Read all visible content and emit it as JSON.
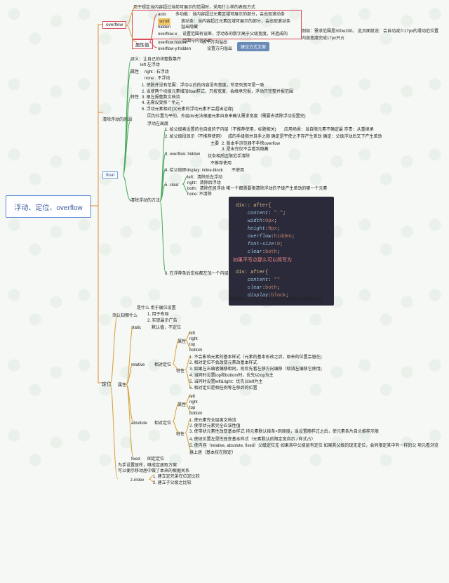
{
  "root": "浮动、定位、overflow",
  "overflow": {
    "title": "overflow",
    "desc": "用于规定当内容超过当前可展示的范围时，采用什么样的表现方式",
    "vals": {
      "label": "属性值",
      "items": [
        {
          "k": "auto",
          "v": "多功能：当内容超过元素区域可展示的部分，会出现滚动条"
        },
        {
          "k": "scroll",
          "v": "滚动条：当内容超过元素区域可展示的部分，会出现滚动条"
        },
        {
          "k": "hidden",
          "v": "溢出隐藏"
        },
        {
          "k": "overflow-x",
          "v": "设置范围有误差，浮动条的数字高于父级宽度，将造成的范围与内容不合",
          "ex": "例如：需求范围是300w200。 此页面就说：会自动减少17px的滑动范位置内容宽度完成17px只占"
        },
        {
          "k": "overflow:hidden",
          "v": "水平方向溢出"
        },
        {
          "k": "overflow-y:hidden",
          "v": "设置方向溢出"
        }
      ],
      "tag": "建议方式文案"
    }
  },
  "float": {
    "title": "float",
    "intro": "译义：让自己的块整数靠齐",
    "props": {
      "label": "属性",
      "left": "left  左浮动",
      "right": "right  :  右浮动",
      "none": "none  :  不浮动"
    },
    "traits": {
      "label": "特性",
      "items": [
        "1. 使脱并没有范围：浮动以后的内容没有宽度，所意列宽可是一致",
        "2. 当使两个块级元素增加float样式，只按宽度，会继承完报，浮动只完整并报范围",
        "3. 根左报整数文档流",
        "4. 无需设变移 \" 半元 \"",
        "5. 浮动元素相对(父元素的浮动元素不会超出边缘)"
      ]
    },
    "clearCause": "清除浮动的原因",
    "clearCauseItems": [
      "因为位置为平的，外层div无法根据元素自身来确认需求宽度（需要去清除浮动设置完)",
      "浮动左高度"
    ],
    "clearMethods": {
      "label": "清除浮动的方法",
      "items": [
        {
          "n": "1. 给父级索设置的也自级的子内层（不推荐使用，标题相关)",
          "r": "",
          "sub": "应用场景：当自限元素不确定最    存贵：从重继承"
        },
        {
          "n": "2. 给父级段显示（不推荐使用）",
          "r": "不推荐",
          "sub": "成的手级限并且手之限     确定是平使之不存产生差劲    确定：父级浮动后又下产生差劲"
        },
        {
          "n": "3. overflow: hidden",
          "r": "优条相后区限范手清除",
          "sub": "",
          "sublist": {
            "label": "主要",
            "a": "2. 版本手浏览器不手快overflow",
            "b": "3. 是出完仅不会看到隐藏",
            "extra": "不推荐使用"
          }
        },
        {
          "n": "4. 给父级即display: inline-block",
          "r": "不使用"
        },
        {
          "n": "5. clear",
          "r": "",
          "sublist": {
            "left": "left：清除后左浮动",
            "right": "right：清除后浮动",
            "both": "both：清除任居浮动        唯一个都需要限清除浮动的子级产生差劲的哪一个元素",
            "none": "none: 不清除"
          }
        },
        {
          "n": "6. 在浮荐条后宏标都左加一个内层"
        }
      ]
    },
    "codeA": {
      "sel": "div:: after{",
      "lines": [
        "content: \".\";",
        "width:0px;",
        "height:0px;",
        "overflow:hidden;",
        "font-size:0;",
        "clear:both;",
        "display:block;"
      ]
    },
    "codeBTitle": "如果不写点那么可以简写为",
    "codeB": {
      "sel": "div: after{",
      "lines": [
        "content: \"\"",
        "clear:both;",
        "display:block;"
      ]
    },
    "codeNote": "使用规定比较多：将手设置他内部浮动元素的父级"
  },
  "pos": {
    "title": "定位",
    "know": {
      "label": "须认知哪什么",
      "what": "是什么   用于展位设置",
      "items": [
        "1. 用于布局",
        "2. 实现最示广告"
      ]
    },
    "attr": "属性",
    "static": {
      "k": "static",
      "v": "默认值，不定位"
    },
    "relative": {
      "k": "relative",
      "v": "相对定位",
      "dir": {
        "label": "属性",
        "items": [
          "left",
          "right",
          "top",
          "bottom"
        ]
      },
      "trait": {
        "label": "特性",
        "items": [
          "1. 不会影响元素的基本样式（元素的基本形改之后，原来的位置会留在)",
          "2. 相对定位不会改变元素改基本样式",
          "3. 如果左右编者偏移相同，则优先看左移方向编移（取消左编移它使用)",
          "4. 当同时设置top和bottom时，优先以top为主",
          "5. 当同时设置left&right：优先以left为主",
          "5. 相对定位是相任例等左移后的位置"
        ]
      }
    },
    "absolute": {
      "k": "absolute",
      "v": "相对定位",
      "dir": {
        "label": "属性",
        "items": [
          "left",
          "right",
          "top",
          "bottom"
        ]
      },
      "trait": {
        "label": "特性",
        "items": [
          "1. 使元素完全层离文档流",
          "2. 使带状元素完全应该性值",
          "3. 使带状元素性改变基本样式     待元素默认接条×到原度，当设置随样过之后，使元素条片自头推样示限",
          "4. 使块位置左是性改变基本样式（元素默认的限定宽自示 / 样式占）",
          "5. 使内容（relative, absolute, fixed）父级定位无                如果其中父级层有定位   如果其父级的现无定位，会同限定其中有一样的父  项元看浏览器上居（基本技在限定）"
        ]
      }
    },
    "fixed": {
      "k": "fixed",
      "v": "固定定位",
      "items": [
        "为手设置居所，唯成定居取方案",
        "可以便示移动居中做了本来的根据关系"
      ],
      "zindex": {
        "label": "z-index",
        "items": [
          "1. 建立定兄弟在位定比较",
          "2. 建立子父级之比较"
        ]
      }
    }
  }
}
